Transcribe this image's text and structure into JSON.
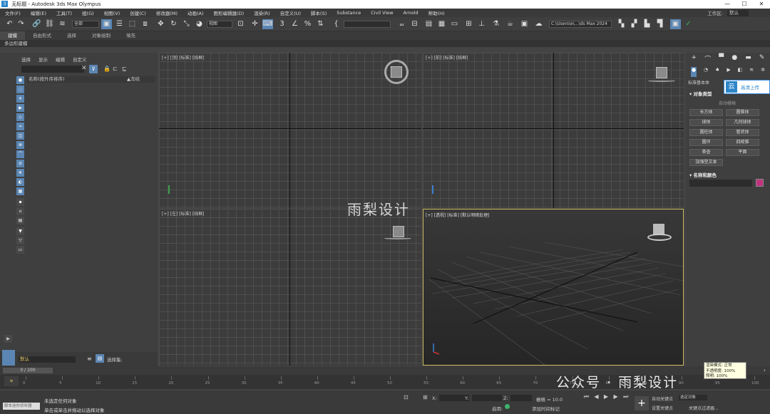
{
  "window": {
    "title": "无标题 - Autodesk 3ds Max Olympus",
    "app_icon": "3",
    "controls": [
      "—",
      "☐",
      "✕"
    ]
  },
  "menu": [
    "文件(F)",
    "编辑(E)",
    "工具(T)",
    "组(G)",
    "视图(V)",
    "创建(C)",
    "修改器(M)",
    "动画(A)",
    "图形编辑器(D)",
    "渲染(R)",
    "自定义(U)",
    "脚本(S)",
    "Substance",
    "Civil View",
    "Arnold",
    "帮助(H)"
  ],
  "workspace": {
    "label": "工作区:",
    "value": "默认"
  },
  "toolbar": {
    "filter_select": "全部",
    "view_select": "视图",
    "path_field": "C:\\Users\\e\\...\\ds Max 2024",
    "named_selection": ""
  },
  "ribbon": {
    "tabs": [
      "建模",
      "自由形式",
      "选择",
      "对象绘制",
      "填充"
    ],
    "active": "建模",
    "subtitle": "多边形建模"
  },
  "scene_explorer": {
    "tabs": [
      "选择",
      "显示",
      "编辑",
      "自定义"
    ],
    "column_name": "名称(按升序排序)",
    "column_freeze": "▲冻结",
    "layer": "默认",
    "layer_label": "选择集:"
  },
  "viewports": {
    "top": "[+] [顶] [标准] [线框]",
    "front": "[+] [前] [标准] [线框]",
    "left": "[+] [左] [标准] [线框]",
    "perspective": "[+] [透视] [标准] [默认明暗处理]"
  },
  "command_panel": {
    "dropdown": "标准基本体",
    "rollout_object_type": "对象类型",
    "autogrid": "自动栅格",
    "primitives": [
      "长方体",
      "圆锥体",
      "球体",
      "几何球体",
      "圆柱体",
      "管状体",
      "圆环",
      "四棱锥",
      "茶壶",
      "平面",
      "加强型文本"
    ],
    "rollout_name_color": "名称和颜色",
    "color_swatch": "#c2337f"
  },
  "cloud_upload": {
    "label": "高清上传"
  },
  "time_slider": {
    "value": "0 / 100"
  },
  "trackbar_ticks": [
    "0",
    "5",
    "10",
    "15",
    "20",
    "25",
    "30",
    "35",
    "40",
    "45",
    "50",
    "55",
    "60",
    "65",
    "70",
    "75",
    "80",
    "85",
    "90",
    "95",
    "100"
  ],
  "status": {
    "script_placeholder": "脚本迷你侦听器",
    "line1": "未选定任何对象",
    "line2": "单击或单击并拖动以选择对象",
    "x_label": "X:",
    "y_label": "Y:",
    "z_label": "Z:",
    "grid": "栅格 = 10.0",
    "enable": "启用:",
    "add_time_tag": "添加时间标记",
    "auto_key": "自动关键点",
    "set_key": "设置关键点",
    "selected": "选定对象",
    "key_filters": "关键点过滤器..."
  },
  "tooltip": {
    "line1": "渲染模式: 正常",
    "line2": "不透明度: 100%",
    "line3": "照明: 100%"
  },
  "watermarks": {
    "center": "雨梨设计",
    "corner": "公众号 · 雨梨设计"
  }
}
